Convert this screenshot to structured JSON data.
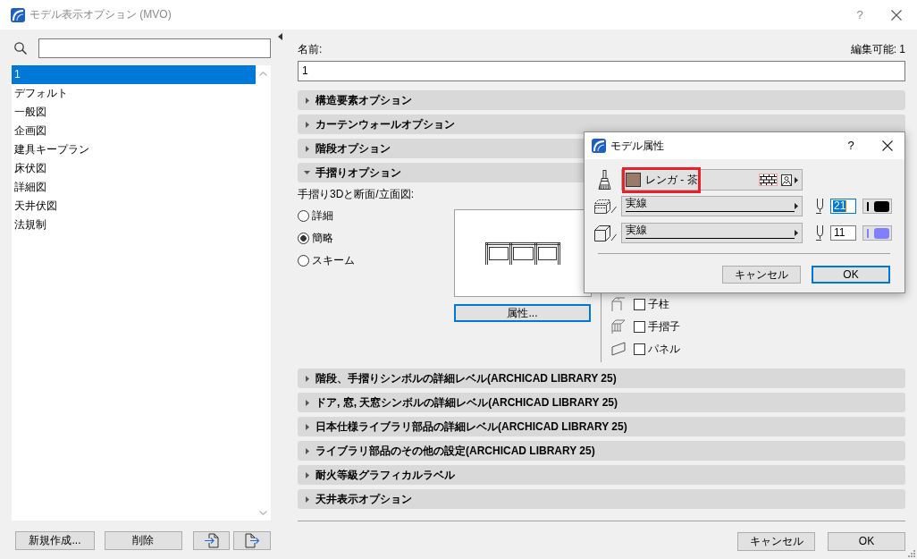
{
  "window": {
    "title": "モデル表示オプション (MVO)",
    "help": "?"
  },
  "sidebar": {
    "items": [
      {
        "label": "1",
        "selected": true
      },
      {
        "label": "デフォルト",
        "selected": false
      },
      {
        "label": "一般図",
        "selected": false
      },
      {
        "label": "企画図",
        "selected": false
      },
      {
        "label": "建具キープラン",
        "selected": false
      },
      {
        "label": "床伏図",
        "selected": false
      },
      {
        "label": "詳細図",
        "selected": false
      },
      {
        "label": "天井伏図",
        "selected": false
      },
      {
        "label": "法規制",
        "selected": false
      }
    ],
    "buttons": [
      {
        "kind": "text",
        "label": "新規作成..."
      },
      {
        "kind": "text",
        "label": "削除"
      },
      {
        "kind": "import"
      },
      {
        "kind": "export"
      }
    ]
  },
  "name_field": {
    "label": "名前:",
    "value": "1"
  },
  "editable": "編集可能: 1",
  "sections": [
    {
      "title": "構造要素オプション",
      "expanded": false
    },
    {
      "title": "カーテンウォールオプション",
      "expanded": false
    },
    {
      "title": "階段オプション",
      "expanded": false
    },
    {
      "title": "手摺りオプション",
      "expanded": true,
      "content": {
        "heading": "手摺り3Dと断面/立面図:",
        "options": [
          {
            "label": "詳細",
            "selected": false
          },
          {
            "label": "簡略",
            "selected": true
          },
          {
            "label": "スキーム",
            "selected": false
          }
        ],
        "attributes_button": {
          "label": "属性...",
          "focused": true
        },
        "components": [
          {
            "kind": "post",
            "label": "子柱",
            "checked": false
          },
          {
            "kind": "baluster",
            "label": "手摺子",
            "checked": false
          },
          {
            "kind": "panel",
            "label": "パネル",
            "checked": false
          }
        ]
      }
    },
    {
      "title": "階段、手摺りシンボルの詳細レベル(ARCHICAD LIBRARY 25)",
      "expanded": false
    },
    {
      "title": "ドア, 窓, 天窓シンボルの詳細レベル(ARCHICAD LIBRARY 25)",
      "expanded": false
    },
    {
      "title": "日本仕様ライブラリ部品の詳細レベル(ARCHICAD LIBRARY 25)",
      "expanded": false
    },
    {
      "title": "ライブラリ部品のその他の設定(ARCHICAD LIBRARY 25)",
      "expanded": false
    },
    {
      "title": "耐火等級グラフィカルラベル",
      "expanded": false
    },
    {
      "title": "天井表示オプション",
      "expanded": false
    }
  ],
  "buttons": [
    {
      "label": "キャンセル",
      "default": false
    },
    {
      "label": "OK",
      "default": false
    }
  ],
  "dialog": {
    "title": "モデル属性",
    "help": "?",
    "surface": {
      "name": "レンガ - 茶",
      "color": "#9a7a68",
      "highlighted": true
    },
    "lines": [
      {
        "kind": "cut",
        "type": "実線",
        "pen": "21",
        "color": "#000000",
        "selected": true
      },
      {
        "kind": "outline",
        "type": "実線",
        "pen": "11",
        "color": "#8080ff",
        "selected": false
      }
    ],
    "buttons": [
      {
        "label": "キャンセル",
        "default": false
      },
      {
        "label": "OK",
        "default": true
      }
    ]
  }
}
